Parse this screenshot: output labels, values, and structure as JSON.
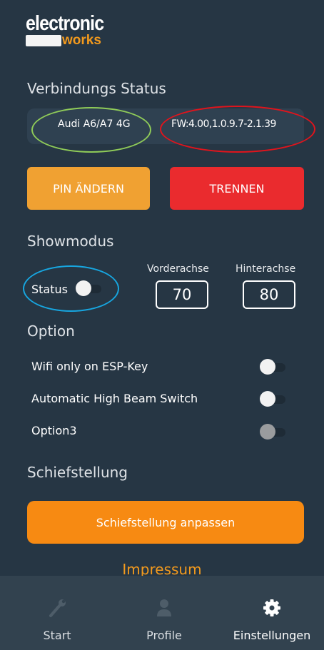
{
  "logo": {
    "line1": "electronic",
    "line2": "works"
  },
  "connection": {
    "title": "Verbindungs Status",
    "car": "Audi A6/A7 4G",
    "firmware": "FW:4.00,1.0.9.7-2.1.39"
  },
  "buttons": {
    "pin": "PIN ÄNDERN",
    "disconnect": "TRENNEN"
  },
  "showmode": {
    "title": "Showmodus",
    "status_label": "Status",
    "status_on": false,
    "front_label": "Vorderachse",
    "front_value": "70",
    "rear_label": "Hinterachse",
    "rear_value": "80"
  },
  "options": {
    "title": "Option",
    "items": [
      {
        "label": "Wifi only on ESP-Key",
        "on": false
      },
      {
        "label": "Automatic High Beam Switch",
        "on": false
      },
      {
        "label": "Option3",
        "on": false,
        "disabled": true
      }
    ]
  },
  "tilt": {
    "title": "Schiefstellung",
    "button": "Schiefstellung anpassen"
  },
  "impressum": "Impressum",
  "nav": {
    "items": [
      {
        "label": "Start",
        "icon": "wrench-icon"
      },
      {
        "label": "Profile",
        "icon": "user-icon"
      },
      {
        "label": "Einstellungen",
        "icon": "gear-icon"
      }
    ]
  },
  "colors": {
    "background": "#263644",
    "accent_orange": "#f78a12",
    "pin_button": "#f0a132",
    "danger": "#ea2b2e",
    "nav_background": "#32424f"
  }
}
